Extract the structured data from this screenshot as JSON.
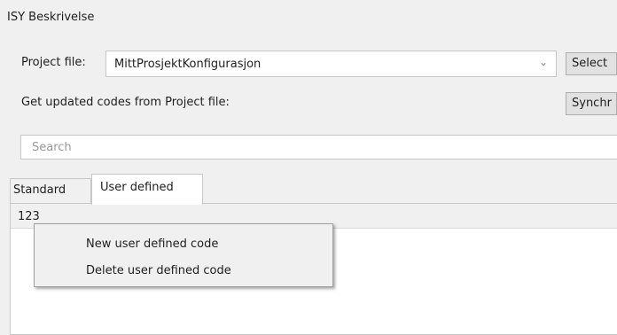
{
  "window": {
    "title": "ISY Beskrivelse"
  },
  "project": {
    "label": "Project file:",
    "selected": "MittProsjektKonfigurasjon",
    "select_button": "Select",
    "dropdown_icon": "chevron-down-icon"
  },
  "sync": {
    "label": "Get updated codes from Project file:",
    "button": "Synchr"
  },
  "search": {
    "placeholder": "Search",
    "value": ""
  },
  "tabs": [
    {
      "label": "Standard",
      "active": false
    },
    {
      "label": "User defined",
      "active": true
    }
  ],
  "list": {
    "rows": [
      {
        "code": "123"
      }
    ]
  },
  "context_menu": {
    "items": [
      {
        "label": "New user defined code"
      },
      {
        "label": "Delete user defined code"
      }
    ]
  }
}
